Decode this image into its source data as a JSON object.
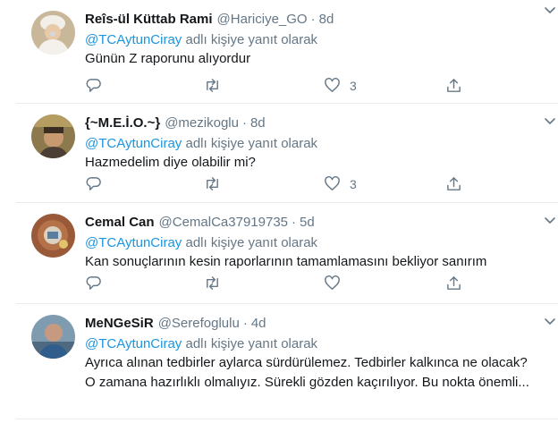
{
  "tweets": [
    {
      "name": "Reîs-ül Küttab Rami",
      "handle": "@Hariciye_GO",
      "time": "8d",
      "reply_prefix": "@TCAytunCiray",
      "reply_suffix": " adlı kişiye yanıt olarak",
      "text": "Günün Z raporunu alıyordur",
      "likes": "3"
    },
    {
      "name": "{~M.E.İ.O.~}",
      "handle": "@mezikoglu",
      "time": "8d",
      "reply_prefix": "@TCAytunCiray",
      "reply_suffix": " adlı kişiye yanıt olarak",
      "text": "Hazmedelim diye olabilir mi?",
      "likes": "3"
    },
    {
      "name": "Cemal Can",
      "handle": "@CemalCa37919735",
      "time": "5d",
      "reply_prefix": "@TCAytunCiray",
      "reply_suffix": " adlı kişiye yanıt olarak",
      "text": "Kan sonuçlarının kesin raporlarının tamamlamasını bekliyor sanırım",
      "likes": ""
    },
    {
      "name": "MeNGeSiR",
      "handle": "@Serefoglulu",
      "time": "4d",
      "reply_prefix": "@TCAytunCiray",
      "reply_suffix": " adlı kişiye yanıt olarak",
      "text": "Ayrıca alınan tedbirler aylarca sürdürülemez. Tedbirler kalkınca ne olacak? O zamana hazırlıklı olmalıyız. Sürekli gözden kaçırılıyor. Bu nokta önemli...",
      "likes": ""
    }
  ],
  "icons": [
    "reply-icon",
    "retweet-icon",
    "like-icon",
    "share-icon",
    "chevron-down-icon"
  ],
  "colors": {
    "link": "#1b95e0",
    "muted": "#657786",
    "text": "#14171a",
    "border": "#e6ecf0"
  }
}
